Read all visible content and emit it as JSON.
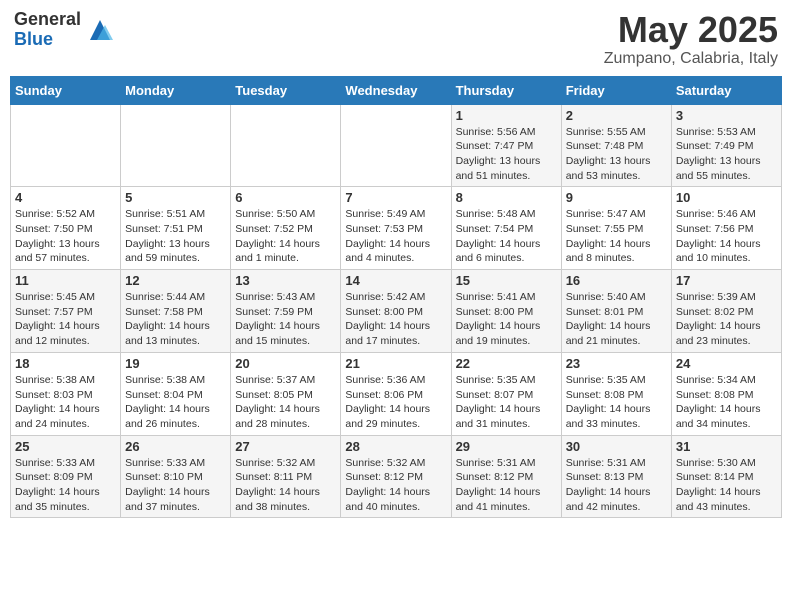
{
  "header": {
    "logo_general": "General",
    "logo_blue": "Blue",
    "month_title": "May 2025",
    "location": "Zumpano, Calabria, Italy"
  },
  "days_of_week": [
    "Sunday",
    "Monday",
    "Tuesday",
    "Wednesday",
    "Thursday",
    "Friday",
    "Saturday"
  ],
  "weeks": [
    [
      {
        "day": "",
        "info": ""
      },
      {
        "day": "",
        "info": ""
      },
      {
        "day": "",
        "info": ""
      },
      {
        "day": "",
        "info": ""
      },
      {
        "day": "1",
        "info": "Sunrise: 5:56 AM\nSunset: 7:47 PM\nDaylight: 13 hours\nand 51 minutes."
      },
      {
        "day": "2",
        "info": "Sunrise: 5:55 AM\nSunset: 7:48 PM\nDaylight: 13 hours\nand 53 minutes."
      },
      {
        "day": "3",
        "info": "Sunrise: 5:53 AM\nSunset: 7:49 PM\nDaylight: 13 hours\nand 55 minutes."
      }
    ],
    [
      {
        "day": "4",
        "info": "Sunrise: 5:52 AM\nSunset: 7:50 PM\nDaylight: 13 hours\nand 57 minutes."
      },
      {
        "day": "5",
        "info": "Sunrise: 5:51 AM\nSunset: 7:51 PM\nDaylight: 13 hours\nand 59 minutes."
      },
      {
        "day": "6",
        "info": "Sunrise: 5:50 AM\nSunset: 7:52 PM\nDaylight: 14 hours\nand 1 minute."
      },
      {
        "day": "7",
        "info": "Sunrise: 5:49 AM\nSunset: 7:53 PM\nDaylight: 14 hours\nand 4 minutes."
      },
      {
        "day": "8",
        "info": "Sunrise: 5:48 AM\nSunset: 7:54 PM\nDaylight: 14 hours\nand 6 minutes."
      },
      {
        "day": "9",
        "info": "Sunrise: 5:47 AM\nSunset: 7:55 PM\nDaylight: 14 hours\nand 8 minutes."
      },
      {
        "day": "10",
        "info": "Sunrise: 5:46 AM\nSunset: 7:56 PM\nDaylight: 14 hours\nand 10 minutes."
      }
    ],
    [
      {
        "day": "11",
        "info": "Sunrise: 5:45 AM\nSunset: 7:57 PM\nDaylight: 14 hours\nand 12 minutes."
      },
      {
        "day": "12",
        "info": "Sunrise: 5:44 AM\nSunset: 7:58 PM\nDaylight: 14 hours\nand 13 minutes."
      },
      {
        "day": "13",
        "info": "Sunrise: 5:43 AM\nSunset: 7:59 PM\nDaylight: 14 hours\nand 15 minutes."
      },
      {
        "day": "14",
        "info": "Sunrise: 5:42 AM\nSunset: 8:00 PM\nDaylight: 14 hours\nand 17 minutes."
      },
      {
        "day": "15",
        "info": "Sunrise: 5:41 AM\nSunset: 8:00 PM\nDaylight: 14 hours\nand 19 minutes."
      },
      {
        "day": "16",
        "info": "Sunrise: 5:40 AM\nSunset: 8:01 PM\nDaylight: 14 hours\nand 21 minutes."
      },
      {
        "day": "17",
        "info": "Sunrise: 5:39 AM\nSunset: 8:02 PM\nDaylight: 14 hours\nand 23 minutes."
      }
    ],
    [
      {
        "day": "18",
        "info": "Sunrise: 5:38 AM\nSunset: 8:03 PM\nDaylight: 14 hours\nand 24 minutes."
      },
      {
        "day": "19",
        "info": "Sunrise: 5:38 AM\nSunset: 8:04 PM\nDaylight: 14 hours\nand 26 minutes."
      },
      {
        "day": "20",
        "info": "Sunrise: 5:37 AM\nSunset: 8:05 PM\nDaylight: 14 hours\nand 28 minutes."
      },
      {
        "day": "21",
        "info": "Sunrise: 5:36 AM\nSunset: 8:06 PM\nDaylight: 14 hours\nand 29 minutes."
      },
      {
        "day": "22",
        "info": "Sunrise: 5:35 AM\nSunset: 8:07 PM\nDaylight: 14 hours\nand 31 minutes."
      },
      {
        "day": "23",
        "info": "Sunrise: 5:35 AM\nSunset: 8:08 PM\nDaylight: 14 hours\nand 33 minutes."
      },
      {
        "day": "24",
        "info": "Sunrise: 5:34 AM\nSunset: 8:08 PM\nDaylight: 14 hours\nand 34 minutes."
      }
    ],
    [
      {
        "day": "25",
        "info": "Sunrise: 5:33 AM\nSunset: 8:09 PM\nDaylight: 14 hours\nand 35 minutes."
      },
      {
        "day": "26",
        "info": "Sunrise: 5:33 AM\nSunset: 8:10 PM\nDaylight: 14 hours\nand 37 minutes."
      },
      {
        "day": "27",
        "info": "Sunrise: 5:32 AM\nSunset: 8:11 PM\nDaylight: 14 hours\nand 38 minutes."
      },
      {
        "day": "28",
        "info": "Sunrise: 5:32 AM\nSunset: 8:12 PM\nDaylight: 14 hours\nand 40 minutes."
      },
      {
        "day": "29",
        "info": "Sunrise: 5:31 AM\nSunset: 8:12 PM\nDaylight: 14 hours\nand 41 minutes."
      },
      {
        "day": "30",
        "info": "Sunrise: 5:31 AM\nSunset: 8:13 PM\nDaylight: 14 hours\nand 42 minutes."
      },
      {
        "day": "31",
        "info": "Sunrise: 5:30 AM\nSunset: 8:14 PM\nDaylight: 14 hours\nand 43 minutes."
      }
    ]
  ]
}
